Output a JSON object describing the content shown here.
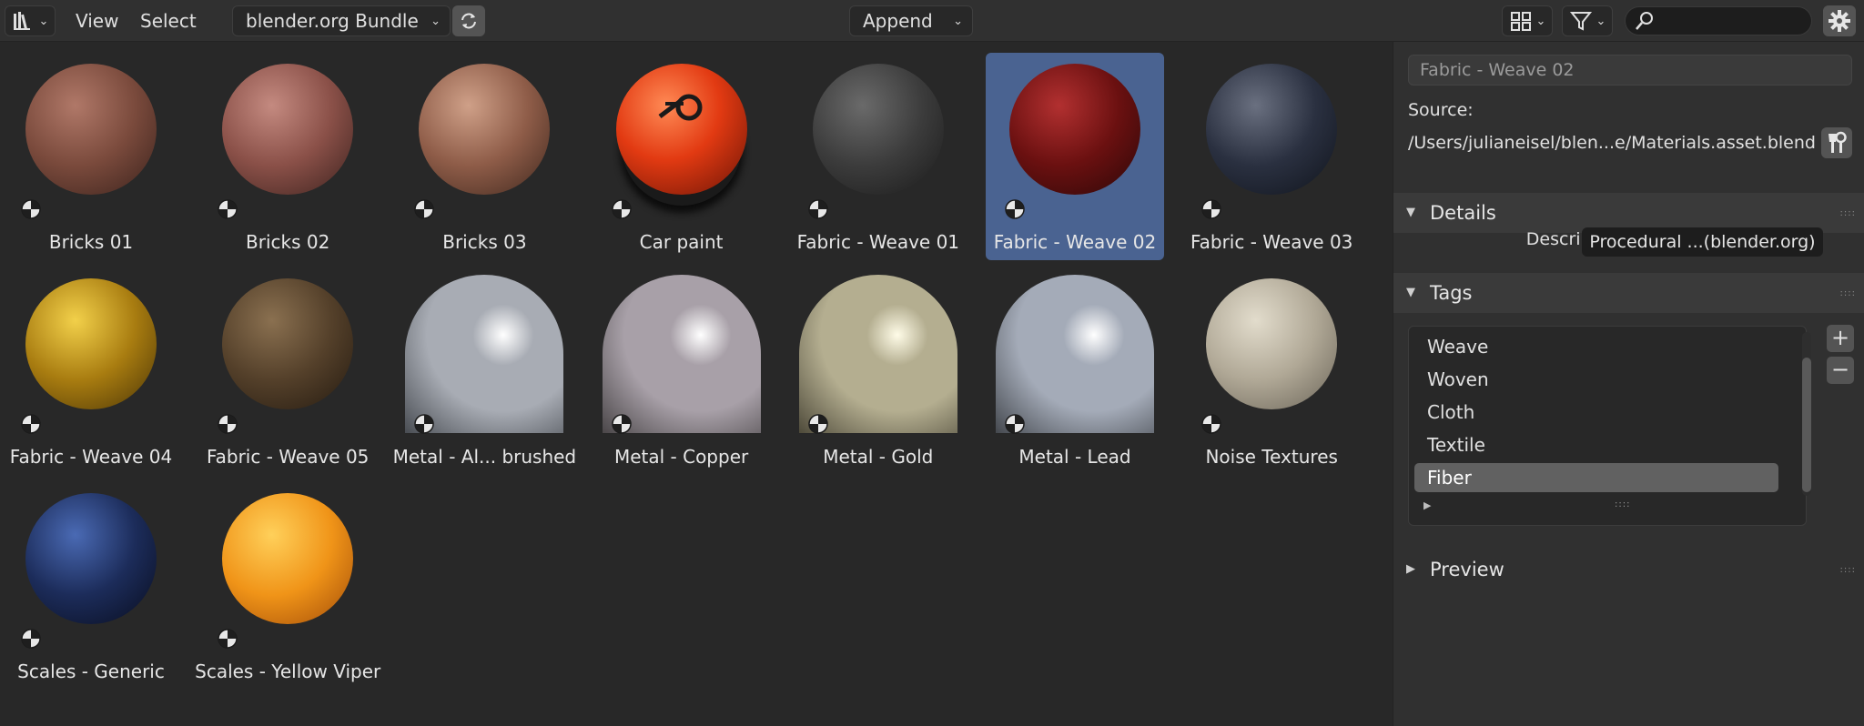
{
  "header": {
    "menus": [
      "View",
      "Select"
    ],
    "library": "blender.org Bundle",
    "import_method": "Append"
  },
  "assets": [
    {
      "label": "Bricks 01",
      "col": 0,
      "row": 0,
      "style": "sphere",
      "colors": [
        "#b07868",
        "#7a4a3c",
        "#3a221c"
      ]
    },
    {
      "label": "Bricks 02",
      "col": 1,
      "row": 0,
      "style": "sphere",
      "colors": [
        "#c48a80",
        "#8a5048",
        "#3c221e"
      ]
    },
    {
      "label": "Bricks 03",
      "col": 2,
      "row": 0,
      "style": "sphere",
      "colors": [
        "#cfa088",
        "#8e5c48",
        "#40281e"
      ]
    },
    {
      "label": "Car paint",
      "col": 3,
      "row": 0,
      "style": "carpaint",
      "colors": [
        "#ff8a55",
        "#e23a12",
        "#6a1406"
      ]
    },
    {
      "label": "Fabric - Weave 01",
      "col": 4,
      "row": 0,
      "style": "sphere",
      "colors": [
        "#6a6a6a",
        "#3c3c3c",
        "#1a1a1a"
      ]
    },
    {
      "label": "Fabric - Weave 02",
      "col": 5,
      "row": 0,
      "style": "sphere",
      "selected": true,
      "colors": [
        "#b23030",
        "#6a1010",
        "#2a0808"
      ]
    },
    {
      "label": "Fabric - Weave 03",
      "col": 6,
      "row": 0,
      "style": "sphere",
      "colors": [
        "#6a7080",
        "#2a3040",
        "#10141c"
      ]
    },
    {
      "label": "Fabric - Weave 04",
      "col": 0,
      "row": 1,
      "style": "sphere",
      "colors": [
        "#f2d04a",
        "#a87c10",
        "#4a3406"
      ]
    },
    {
      "label": "Fabric - Weave 05",
      "col": 1,
      "row": 1,
      "style": "sphere",
      "colors": [
        "#8a7050",
        "#54402a",
        "#241a10"
      ]
    },
    {
      "label": "Metal - Al... brushed",
      "col": 2,
      "row": 1,
      "style": "dome",
      "colors": [
        "#ffffff",
        "#a8acb4",
        "#484c52"
      ]
    },
    {
      "label": "Metal - Copper",
      "col": 3,
      "row": 1,
      "style": "dome",
      "colors": [
        "#ffffff",
        "#a8a0a8",
        "#4a4648"
      ]
    },
    {
      "label": "Metal - Gold",
      "col": 4,
      "row": 1,
      "style": "dome",
      "colors": [
        "#fffce8",
        "#b4ae90",
        "#4e4a3a"
      ]
    },
    {
      "label": "Metal - Lead",
      "col": 5,
      "row": 1,
      "style": "dome",
      "colors": [
        "#ffffff",
        "#a4abb8",
        "#44484e"
      ]
    },
    {
      "label": "Noise Textures",
      "col": 6,
      "row": 1,
      "style": "sphere",
      "colors": [
        "#e2dccc",
        "#b0a896",
        "#6a6458"
      ]
    },
    {
      "label": "Scales - Generic",
      "col": 0,
      "row": 2,
      "style": "sphere",
      "colors": [
        "#4a6ab4",
        "#1c2c5a",
        "#080c1c"
      ]
    },
    {
      "label": "Scales - Yellow Viper",
      "col": 1,
      "row": 2,
      "style": "sphere",
      "colors": [
        "#ffd05a",
        "#f09418",
        "#a04a08"
      ]
    }
  ],
  "sidebar": {
    "asset_name": "Fabric - Weave 02",
    "source_label": "Source:",
    "source_path": "/Users/julianeisel/blen...e/Materials.asset.blend",
    "details_title": "Details",
    "description_label": "Description",
    "description_value": "Procedural ...(blender.org)",
    "tags_title": "Tags",
    "tags": [
      "Weave",
      "Woven",
      "Cloth",
      "Textile",
      "Fiber"
    ],
    "active_tag": "Fiber",
    "add_label": "+",
    "remove_label": "−",
    "preview_title": "Preview"
  },
  "colors": {
    "selection": "#4a6391",
    "background": "#282828",
    "panel": "#303030"
  }
}
